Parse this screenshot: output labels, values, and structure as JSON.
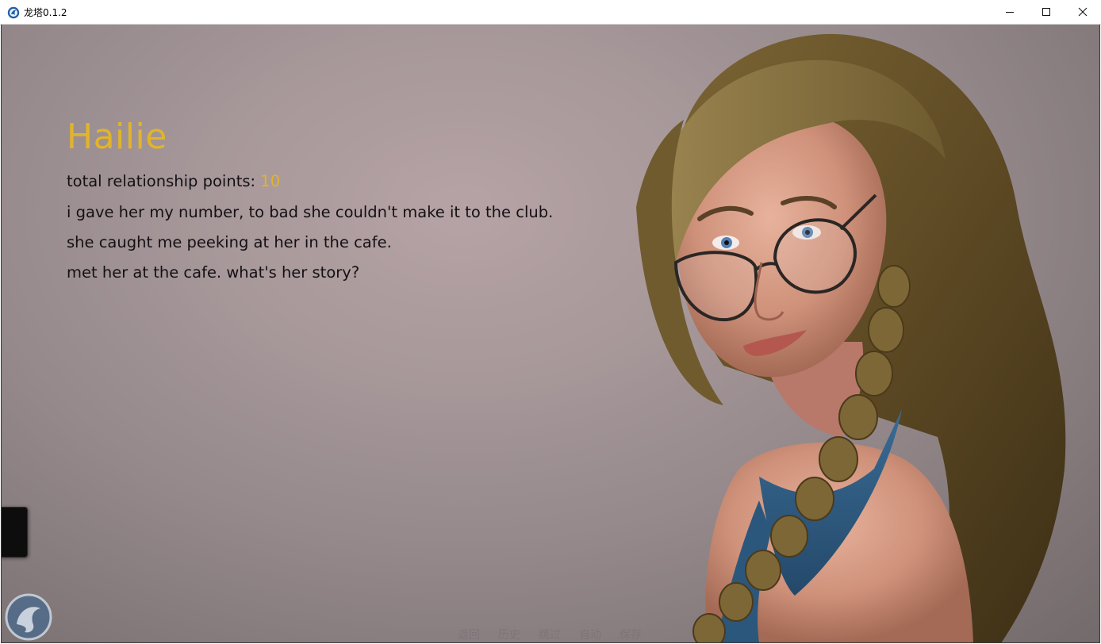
{
  "window": {
    "title": "龙塔0.1.2",
    "app_icon": "app-logo-icon",
    "controls": [
      "minimize-icon",
      "maximize-icon",
      "close-icon"
    ]
  },
  "character": {
    "name": "Hailie",
    "name_color": "#e2b42a",
    "points_label": "total relationship points:",
    "points_value": "10",
    "notes": [
      "i gave her my number, to bad she couldn't make it to the club.",
      "she caught me peeking at her in the cafe.",
      "met her at the cafe. what's her story?"
    ]
  },
  "quick_menu": {
    "items": [
      "返回",
      "历史",
      "跳过",
      "自动",
      "保存"
    ]
  },
  "colors": {
    "background": "#a7989a",
    "text": "#141014",
    "accent": "#e2b42a",
    "quick_menu_text": "#7d7579"
  }
}
